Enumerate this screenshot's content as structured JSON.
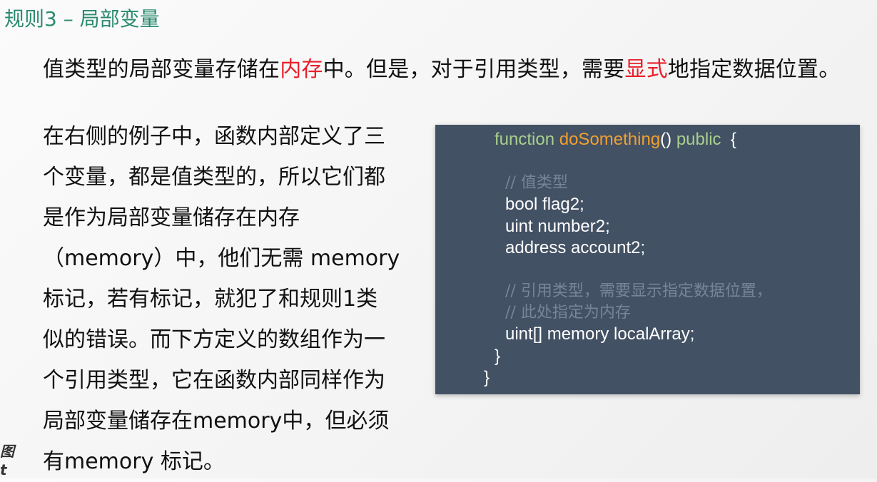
{
  "slide": {
    "title": "规则3 – 局部变量"
  },
  "intro": {
    "part1": "值类型的局部变量存储在",
    "highlight1": "内存",
    "part2": "中。但是，对于引用类型，需要",
    "highlight2": "显式",
    "part3": "地指定数据位置。"
  },
  "body": {
    "lines": [
      "在右侧的例子中，函数内部定义了三",
      "个变量，都是值类型的，所以它们都",
      "是作为局部变量储存在内存",
      "（memory）中，他们无需 memory",
      "标记，若有标记，就犯了和规则1类",
      "似的错误。而下方定义的数组作为一",
      "个引用类型，它在函数内部同样作为",
      "局部变量储存在memory中，但必须",
      "有memory 标记。"
    ]
  },
  "code": {
    "kw_function": "function",
    "fn_name": "doSomething",
    "parens": "()",
    "kw_public": "public",
    "open_brace": "{",
    "comment1": "// 值类型",
    "line_bool": "bool flag2;",
    "line_uint": "uint number2;",
    "line_address": "address account2;",
    "comment2": "// 引用类型，需要显示指定数据位置，",
    "comment3": "// 此处指定为内存",
    "line_array": "uint[] memory localArray;",
    "close_inner": "}",
    "close_outer": "}"
  },
  "logo": {
    "line1": "图",
    "line2": "t"
  },
  "colors": {
    "title": "#2a8a6f",
    "highlight": "#e8202a",
    "code_bg": "#435164",
    "keyword": "#a8d08d",
    "function_name": "#f0a030",
    "comment": "#76859a"
  }
}
